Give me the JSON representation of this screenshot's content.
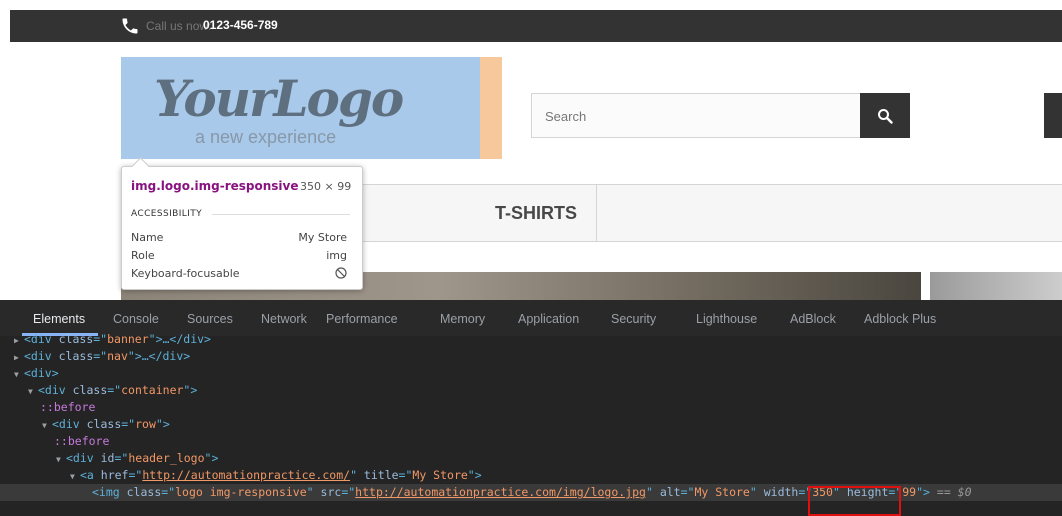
{
  "topbar": {
    "call_label": "Call us now:",
    "phone_number": "0123-456-789"
  },
  "logo": {
    "mark_text": "YourLogo",
    "tagline": "a new experience"
  },
  "search": {
    "placeholder": "Search"
  },
  "menu": {
    "tshirts_label": "T-SHIRTS"
  },
  "tooltip": {
    "selector": "img.logo.img-responsive",
    "dimensions": "350 × 99",
    "section": "ACCESSIBILITY",
    "rows": [
      {
        "label": "Name",
        "value": "My Store"
      },
      {
        "label": "Role",
        "value": "img"
      },
      {
        "label": "Keyboard-focusable",
        "value": ""
      }
    ]
  },
  "devtools": {
    "tabs": [
      "Elements",
      "Console",
      "Sources",
      "Network",
      "Performance",
      "Memory",
      "Application",
      "Security",
      "Lighthouse",
      "AdBlock",
      "Adblock Plus"
    ],
    "lines": {
      "l1_class": "banner",
      "l2_class": "nav",
      "l4_class": "container",
      "pseudo_before": "::before",
      "l6_class": "row",
      "l8_id": "header_logo",
      "l9_href": "http://automationpractice.com/",
      "l9_title": "My Store",
      "l10_class": "logo img-responsive",
      "l10_src": "http://automationpractice.com/img/logo.jpg",
      "l10_alt": "My Store",
      "l10_width": "350",
      "l10_height": "99",
      "l10_suffix": "== $0"
    }
  },
  "colors": {
    "accent_tab": "#8ab4f8",
    "highlight": "#e01010"
  }
}
